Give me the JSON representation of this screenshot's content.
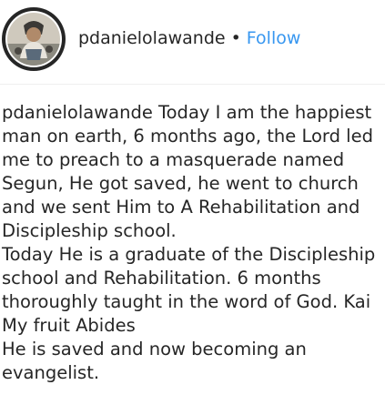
{
  "post": {
    "username": "pdanielolawande",
    "separator": "•",
    "follow_label": "Follow",
    "avatar_icon": "profile-photo"
  },
  "caption": {
    "username": "pdanielolawande",
    "line1": "Today I am the happiest man on earth, 6 months ago, the Lord led me to preach to a masquerade named Segun, He got saved, he went to church and we sent Him to A Rehabilitation and Discipleship school.",
    "line2": "Today He is a graduate of the Discipleship school and Rehabilitation. 6 months thoroughly taught in the word of God. Kai My fruit Abides",
    "line3": "He is saved and now becoming an evangelist."
  },
  "colors": {
    "text": "#262626",
    "link": "#3897f0",
    "divider": "#efefef"
  }
}
